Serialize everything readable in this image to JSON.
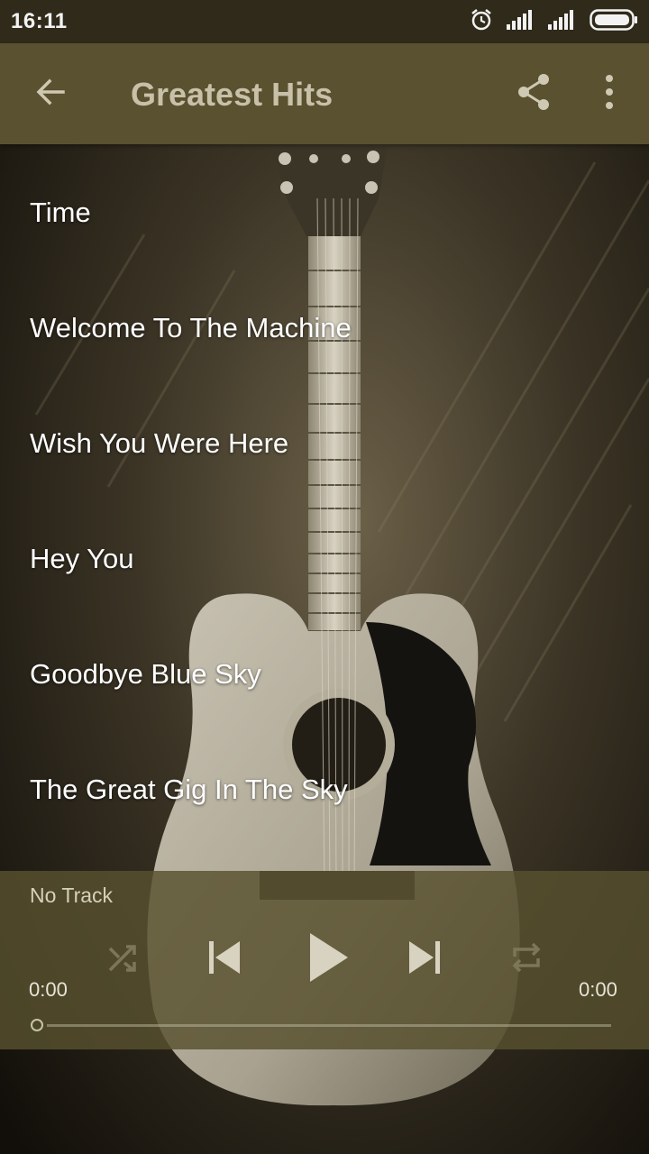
{
  "status_bar": {
    "time": "16:11",
    "icons": [
      "alarm-icon",
      "signal-icon",
      "signal-icon",
      "battery-icon"
    ]
  },
  "app_bar": {
    "title": "Greatest Hits",
    "back_icon": "arrow-back-icon",
    "share_icon": "share-icon",
    "more_icon": "more-vert-icon"
  },
  "tracks": [
    {
      "title": "Time"
    },
    {
      "title": "Welcome To The Machine"
    },
    {
      "title": "Wish You Were Here"
    },
    {
      "title": "Hey You"
    },
    {
      "title": "Goodbye Blue Sky"
    },
    {
      "title": "The Great Gig In The Sky"
    }
  ],
  "player": {
    "now_playing": "No Track",
    "current_time": "0:00",
    "total_time": "0:00",
    "progress": 0,
    "controls": [
      "shuffle-icon",
      "skip-previous-icon",
      "play-icon",
      "skip-next-icon",
      "repeat-icon"
    ]
  },
  "colors": {
    "status_bar": "#2f2a1a",
    "app_bar": "#59512f",
    "title_text": "#c8c0a8",
    "track_text": "#ffffff",
    "player_panel": "#58502e"
  }
}
